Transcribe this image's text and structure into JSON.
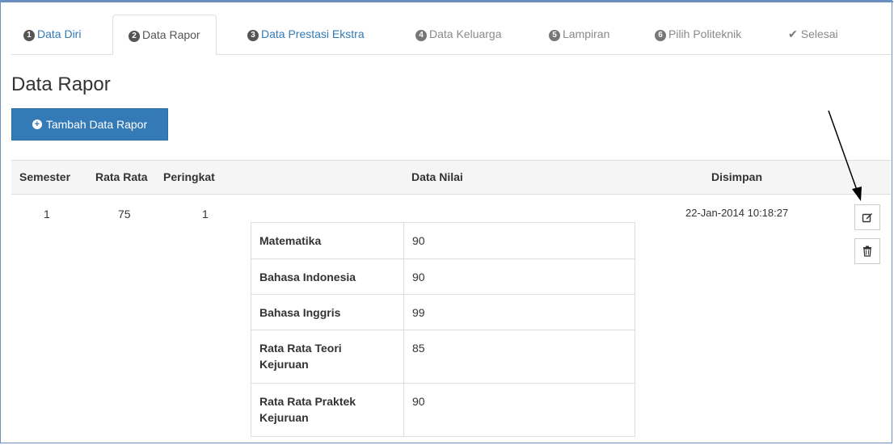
{
  "tabs": [
    {
      "num": "1",
      "label": "Data Diri"
    },
    {
      "num": "2",
      "label": "Data Rapor"
    },
    {
      "num": "3",
      "label": "Data Prestasi Ekstra"
    },
    {
      "num": "4",
      "label": "Data Keluarga"
    },
    {
      "num": "5",
      "label": "Lampiran"
    },
    {
      "num": "6",
      "label": "Pilih Politeknik"
    },
    {
      "label": "Selesai"
    }
  ],
  "page_title": "Data Rapor",
  "add_button_label": "Tambah Data Rapor",
  "table": {
    "headers": {
      "semester": "Semester",
      "rata_rata": "Rata Rata",
      "peringkat": "Peringkat",
      "data_nilai": "Data Nilai",
      "disimpan": "Disimpan"
    },
    "row": {
      "semester": "1",
      "rata_rata": "75",
      "peringkat": "1",
      "disimpan": "22-Jan-2014 10:18:27",
      "nilai": [
        {
          "subject": "Matematika",
          "value": "90"
        },
        {
          "subject": "Bahasa Indonesia",
          "value": "90"
        },
        {
          "subject": "Bahasa Inggris",
          "value": "99"
        },
        {
          "subject": "Rata Rata Teori Kejuruan",
          "value": "85"
        },
        {
          "subject": "Rata Rata Praktek Kejuruan",
          "value": "90"
        }
      ]
    }
  },
  "icons": {
    "add": "plus-circle-icon",
    "edit": "edit-icon",
    "delete": "trash-icon",
    "done": "check-icon"
  },
  "colors": {
    "primary": "#337ab7",
    "link": "#337ab7",
    "header_bg": "#f5f5f5",
    "border": "#dddddd",
    "frame": "#6a8fc0"
  }
}
